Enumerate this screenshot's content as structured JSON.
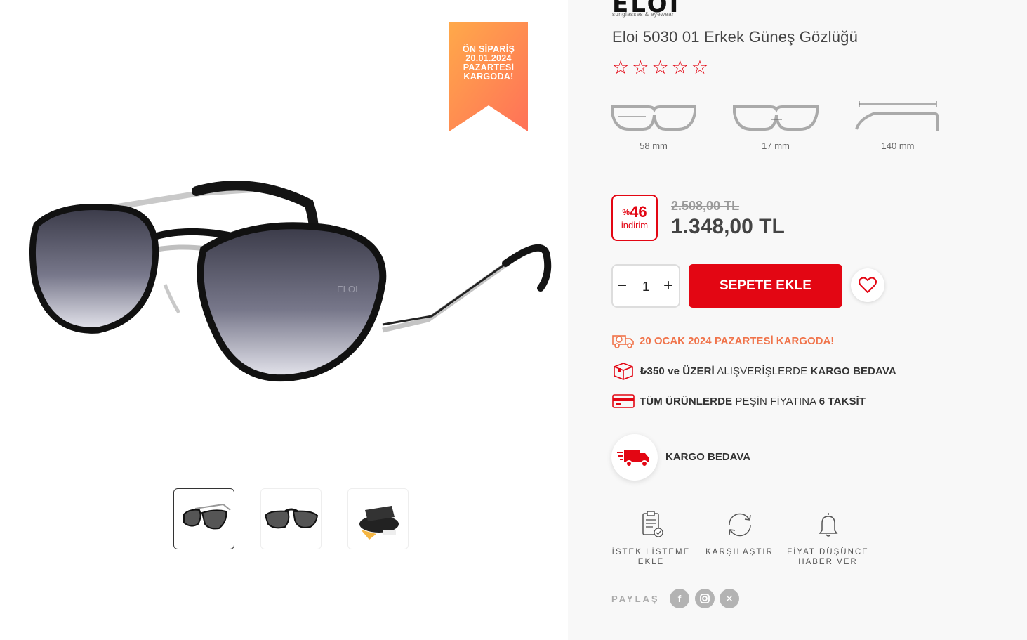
{
  "ribbon": {
    "line1": "ÖN SİPARİŞ",
    "line2": "20.01.2024",
    "line3": "PAZARTESİ",
    "line4": "KARGODA!"
  },
  "brand": {
    "logo": "ELOI",
    "sub": "sunglasses & eyewear"
  },
  "product": {
    "title": "Eloi 5030 01 Erkek Güneş Gözlüğü",
    "rating_stars": 5,
    "lens_mark": "ELOI"
  },
  "measurements": {
    "lens_width": "58 mm",
    "bridge_width": "17 mm",
    "temple_length": "140 mm"
  },
  "pricing": {
    "discount_symbol": "%",
    "discount_value": "46",
    "discount_word": "indirim",
    "old_price": "2.508,00 TL",
    "new_price": "1.348,00 TL"
  },
  "cart": {
    "quantity": "1",
    "minus": "−",
    "plus": "+",
    "add_label": "SEPETE EKLE"
  },
  "info": {
    "shipping_date": "20 OCAK 2024 PAZARTESİ KARGODA!",
    "free_ship_prefix": "₺350 ve ÜZERİ",
    "free_ship_mid": " ALIŞVERİŞLERDE ",
    "free_ship_suffix": "KARGO BEDAVA",
    "install_prefix": "TÜM ÜRÜNLERDE",
    "install_mid": " PEŞİN FİYATINA ",
    "install_suffix": "6 TAKSİT"
  },
  "free_shipping_badge": "KARGO BEDAVA",
  "actions": {
    "wishlist_line1": "İSTEK LİSTEME",
    "wishlist_line2": "EKLE",
    "compare": "KARŞILAŞTIR",
    "price_alert_line1": "FİYAT DÜŞÜNCE",
    "price_alert_line2": "HABER VER"
  },
  "share": {
    "label": "PAYLAŞ",
    "facebook": "f",
    "x": "✕"
  },
  "colors": {
    "accent": "#e30613",
    "shipping": "#f0734a",
    "ribbon_top": "#ffa24a",
    "ribbon_bottom": "#ff7a55"
  }
}
